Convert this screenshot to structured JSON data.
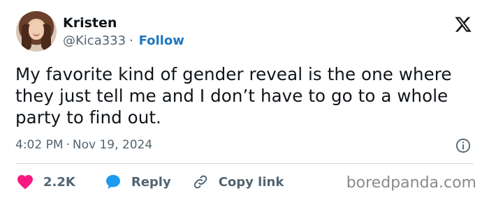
{
  "author": {
    "name": "Kristen",
    "handle": "@Kica333",
    "separator": "·",
    "follow_label": "Follow"
  },
  "tweet": {
    "text": "My favorite kind of gender reveal is the one where they just tell me and I don’t have to go to a whole party to find out."
  },
  "meta": {
    "time": "4:02 PM",
    "separator": "·",
    "date": "Nov 19, 2024"
  },
  "actions": {
    "likes_count": "2.2K",
    "reply_label": "Reply",
    "copy_link_label": "Copy link"
  },
  "watermark": "boredpanda.com",
  "icons": {
    "logo": "x-logo-icon",
    "info": "info-icon",
    "like": "heart-icon",
    "reply": "speech-bubble-icon",
    "copy": "link-icon"
  },
  "colors": {
    "text": "#0f1419",
    "secondary": "#536471",
    "link": "#1d77c2",
    "heart": "#f91880",
    "reply_bubble": "#1d9bf0",
    "divider": "#cfd9de"
  }
}
